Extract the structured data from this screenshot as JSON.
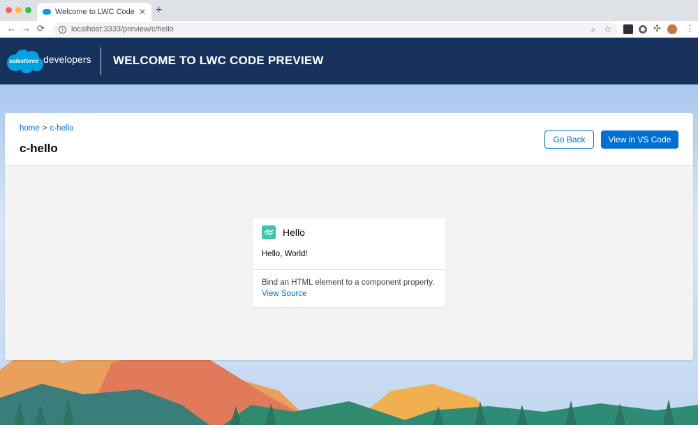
{
  "browser": {
    "tab_title": "Welcome to LWC Code Preview",
    "tab_close": "✕",
    "new_tab": "+",
    "back": "←",
    "forward": "→",
    "reload": "⟳",
    "url": "localhost:3333/preview/c/hello",
    "info_icon": "i",
    "zoom_icon": "⌕",
    "bookmark_icon": "☆",
    "menu_icon": "⋮",
    "extension_icon": "✣",
    "icons": [
      "info-icon",
      "zoom-icon",
      "bookmark-star-icon",
      "extension-puzzle-icon",
      "profile-avatar",
      "menu-dots-icon"
    ]
  },
  "header": {
    "logo_text": "salesforce",
    "developers_text": "developers",
    "title": "Welcome to LWC Code Preview",
    "colors": {
      "background": "#16325c",
      "logo": "#00a1e0"
    }
  },
  "panel": {
    "breadcrumb": {
      "home": "home",
      "separator": ">",
      "current": "c-hello"
    },
    "title": "c-hello",
    "go_back_label": "Go Back",
    "view_vscode_label": "View in VS Code",
    "colors": {
      "brand": "#0070d2"
    }
  },
  "card": {
    "title": "Hello",
    "body": "Hello, World!",
    "description": "Bind an HTML element to a component property.",
    "link": "View Source",
    "icon": "handshake-icon",
    "icon_color": "#3bc8b1"
  }
}
